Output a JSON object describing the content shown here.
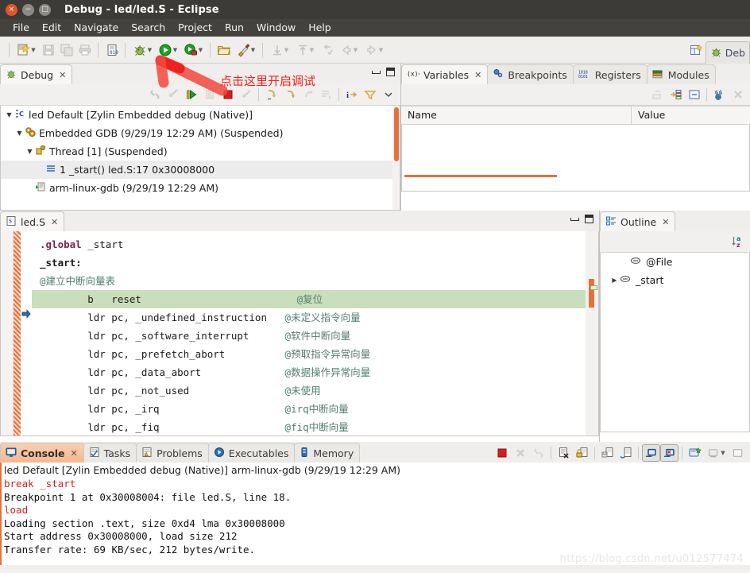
{
  "window": {
    "title": "Debug - led/led.S - Eclipse",
    "buttons": {
      "close": "×",
      "minimize": "−",
      "maximize": "□"
    }
  },
  "menubar": {
    "items": [
      "File",
      "Edit",
      "Navigate",
      "Search",
      "Project",
      "Run",
      "Window",
      "Help"
    ]
  },
  "toolbar": {
    "icons": [
      {
        "name": "new-wizard-icon",
        "dropdown": true
      },
      {
        "name": "save-icon",
        "dropdown": false
      },
      {
        "name": "save-all-icon",
        "dropdown": false
      },
      {
        "name": "print-icon",
        "dropdown": false
      },
      {
        "name": "toggle-source-icon",
        "dropdown": false
      },
      {
        "name": "debug-icon",
        "dropdown": true
      },
      {
        "name": "run-icon",
        "dropdown": true
      },
      {
        "name": "external-tools-icon",
        "dropdown": true
      },
      {
        "name": "open-folder-icon",
        "dropdown": false
      },
      {
        "name": "build-icon",
        "dropdown": true
      },
      {
        "name": "next-annotation-icon",
        "dropdown": true
      },
      {
        "name": "previous-annotation-icon",
        "dropdown": true
      },
      {
        "name": "last-edit-location-icon",
        "dropdown": false
      },
      {
        "name": "back-icon",
        "dropdown": true
      },
      {
        "name": "forward-icon",
        "dropdown": true
      }
    ],
    "open-perspective-icon": "open-perspective-icon",
    "perspective_label": "Deb"
  },
  "annotation": {
    "text": "点击这里开启调试",
    "color": "#ee2222"
  },
  "debug_view": {
    "tab_label": "Debug",
    "close_glyph": "✕",
    "toolbar_icons": [
      "disconnect-icon",
      "remove-all-terminated-icon",
      "resume-icon",
      "suspend-icon",
      "terminate-icon",
      "terminate-all-icon",
      "step-into-icon",
      "step-over-icon",
      "step-return-icon",
      "drop-to-frame-icon",
      "instruction-stepping-icon",
      "use-step-filters-icon",
      "view-menu-icon"
    ],
    "tree": [
      {
        "indent": 0,
        "arrow": "▼",
        "icon": "launch-config-icon",
        "label": "led Default [Zylin Embedded debug (Native)]",
        "selected": false
      },
      {
        "indent": 1,
        "arrow": "▼",
        "icon": "gdb-process-icon",
        "label": "Embedded GDB (9/29/19 12:29 AM) (Suspended)",
        "selected": false
      },
      {
        "indent": 2,
        "arrow": "▼",
        "icon": "thread-icon",
        "label": "Thread [1] (Suspended)",
        "selected": false
      },
      {
        "indent": 3,
        "arrow": "",
        "icon": "stack-frame-icon",
        "label": "1 _start() led.S:17 0x30008000",
        "selected": true
      },
      {
        "indent": 2,
        "arrow": "",
        "icon": "gdb-exe-icon",
        "label": "arm-linux-gdb (9/29/19 12:29 AM)",
        "selected": false
      }
    ]
  },
  "variables_view": {
    "tabs": [
      {
        "label": "Variables",
        "icon": "variables-icon",
        "active": true,
        "closable": true
      },
      {
        "label": "Breakpoints",
        "icon": "breakpoints-icon",
        "active": false,
        "closable": false
      },
      {
        "label": "Registers",
        "icon": "registers-icon",
        "active": false,
        "closable": false
      },
      {
        "label": "Modules",
        "icon": "modules-icon",
        "active": false,
        "closable": false
      }
    ],
    "toolbar_icons": [
      "collapse-all-icon",
      "show-type-names-icon",
      "show-logical-structure-icon",
      "layout-icon",
      "view-menu-icon"
    ],
    "columns": [
      "Name",
      "Value"
    ],
    "rows": []
  },
  "editor": {
    "tab_label": "led.S",
    "tab_icon": "assembly-file-icon",
    "close_glyph": "✕",
    "lines": [
      {
        "marker": "",
        "highlight": false,
        "segments": [
          {
            "text": ".global",
            "cls": "kw"
          },
          {
            "text": " _start",
            "cls": "ins"
          }
        ]
      },
      {
        "marker": "",
        "highlight": false,
        "segments": [
          {
            "text": "_start:",
            "cls": "lbl"
          }
        ]
      },
      {
        "marker": "",
        "highlight": false,
        "segments": [
          {
            "text": "@建立中断向量表",
            "cls": "cmt"
          }
        ]
      },
      {
        "marker": "instruction-pointer",
        "highlight": true,
        "segments": [
          {
            "text": "        b   reset",
            "cls": "ins"
          },
          {
            "text": "                          @复位",
            "cls": "cmt"
          }
        ]
      },
      {
        "marker": "",
        "highlight": false,
        "segments": [
          {
            "text": "        ldr pc, _undefined_instruction",
            "cls": "ins"
          },
          {
            "text": "   @未定义指令向量",
            "cls": "cmt"
          }
        ]
      },
      {
        "marker": "",
        "highlight": false,
        "segments": [
          {
            "text": "        ldr pc, _software_interrupt",
            "cls": "ins"
          },
          {
            "text": "      @软件中断向量",
            "cls": "cmt"
          }
        ]
      },
      {
        "marker": "",
        "highlight": false,
        "segments": [
          {
            "text": "        ldr pc, _prefetch_abort",
            "cls": "ins"
          },
          {
            "text": "          @预取指令异常向量",
            "cls": "cmt"
          }
        ]
      },
      {
        "marker": "",
        "highlight": false,
        "segments": [
          {
            "text": "        ldr pc, _data_abort",
            "cls": "ins"
          },
          {
            "text": "              @数据操作异常向量",
            "cls": "cmt"
          }
        ]
      },
      {
        "marker": "",
        "highlight": false,
        "segments": [
          {
            "text": "        ldr pc, _not_used",
            "cls": "ins"
          },
          {
            "text": "                @未使用",
            "cls": "cmt"
          }
        ]
      },
      {
        "marker": "",
        "highlight": false,
        "segments": [
          {
            "text": "        ldr pc, _irq",
            "cls": "ins"
          },
          {
            "text": "                     @irq中断向量",
            "cls": "cmt"
          }
        ]
      },
      {
        "marker": "",
        "highlight": false,
        "segments": [
          {
            "text": "        ldr pc, _fiq",
            "cls": "ins"
          },
          {
            "text": "                     @fiq中断向量",
            "cls": "cmt"
          }
        ]
      }
    ]
  },
  "outline_view": {
    "tab_label": "Outline",
    "tab_icon": "outline-icon",
    "close_glyph": "✕",
    "toolbar_icons": [
      "sort-az-icon"
    ],
    "items": [
      {
        "arrow": "",
        "icon": "assembly-element-icon",
        "label": "@File"
      },
      {
        "arrow": "▶",
        "icon": "assembly-element-icon",
        "label": "_start"
      }
    ]
  },
  "console_view": {
    "tabs": [
      {
        "label": "Console",
        "icon": "console-icon",
        "active": true,
        "closable": true
      },
      {
        "label": "Tasks",
        "icon": "tasks-icon",
        "active": false,
        "closable": false
      },
      {
        "label": "Problems",
        "icon": "problems-icon",
        "active": false,
        "closable": false
      },
      {
        "label": "Executables",
        "icon": "executables-icon",
        "active": false,
        "closable": false
      },
      {
        "label": "Memory",
        "icon": "memory-icon",
        "active": false,
        "closable": false
      }
    ],
    "toolbar_icons": [
      "terminate-icon",
      "remove-launch-icon",
      "remove-all-terminated-icon",
      "clear-console-icon",
      "scroll-lock-icon",
      "pin-console-icon",
      "word-wrap-icon",
      "display-selected-console-icon",
      "open-console-icon",
      "new-console-view-icon",
      "console-menu-icon",
      "minimize-icon"
    ],
    "title": "led Default [Zylin Embedded debug (Native)] arm-linux-gdb (9/29/19 12:29 AM)",
    "output": [
      {
        "text": "break _start",
        "color": "red"
      },
      {
        "text": "Breakpoint 1 at 0x30008004: file led.S, line 18.",
        "color": "black"
      },
      {
        "text": "load",
        "color": "red"
      },
      {
        "text": "Loading section .text, size 0xd4 lma 0x30008000",
        "color": "black"
      },
      {
        "text": "Start address 0x30008000, load size 212",
        "color": "black"
      },
      {
        "text": "Transfer rate: 69 KB/sec, 212 bytes/write.",
        "color": "black"
      }
    ]
  },
  "watermark": "https://blog.csdn.net/u012577474",
  "colors": {
    "accent_orange": "#e8703a",
    "highlight_green": "#c9debb",
    "selection_blue": "#dfeaf7",
    "annotation_red": "#ee2222",
    "titlebar": "#3c3b37"
  }
}
